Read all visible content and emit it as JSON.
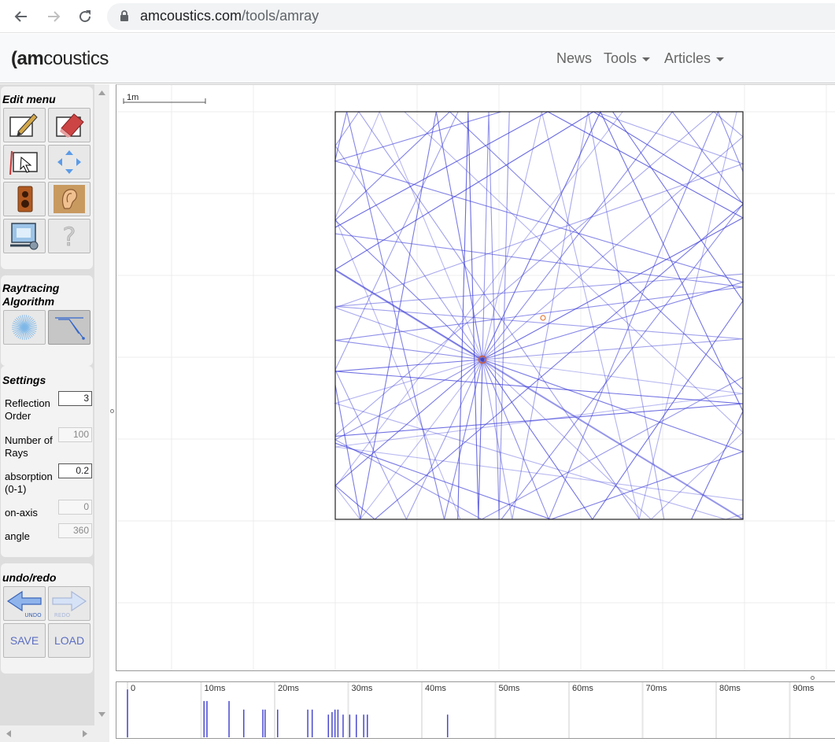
{
  "browser": {
    "url_host": "amcoustics.com",
    "url_path": "/tools/amray"
  },
  "site": {
    "logo_prefix": "(am",
    "logo_suffix": "coustics",
    "nav": {
      "news": "News",
      "tools": "Tools",
      "articles": "Articles"
    }
  },
  "panel": {
    "edit_menu_title": "Edit menu",
    "raytracing_title_line1": "Raytracing",
    "raytracing_title_line2": "Algorithm",
    "settings_title": "Settings",
    "settings": {
      "reflection_order_label_1": "Reflection",
      "reflection_order_label_2": "Order",
      "reflection_order_value": "3",
      "number_of_rays_label_1": "Number of",
      "number_of_rays_label_2": "Rays",
      "number_of_rays_value": "100",
      "absorption_label_1": "absorption",
      "absorption_label_2": "(0-1)",
      "absorption_value": "0.2",
      "on_axis_label": "on-axis",
      "on_axis_value": "0",
      "angle_label": "angle",
      "angle_value": "360"
    },
    "undo_redo_title": "undo/redo",
    "undo_label": "UNDO",
    "redo_label": "REDO",
    "save_label": "SAVE",
    "load_label": "LOAD"
  },
  "canvas": {
    "scale_label": "1m",
    "colors": {
      "ray": "#3a3ad8",
      "grid": "#ececec",
      "room_border": "#222222",
      "source": "#d06030",
      "listener": "#e08040"
    }
  },
  "impulse": {
    "tick_labels": [
      "0",
      "10ms",
      "20ms",
      "30ms",
      "40ms",
      "50ms",
      "60ms",
      "70ms",
      "80ms",
      "90ms"
    ],
    "arrival_times_ms": [
      0,
      10.4,
      10.8,
      13.8,
      15.8,
      18.4,
      18.7,
      20.4,
      24.5,
      25.1,
      27.3,
      27.8,
      28.2,
      28.6,
      29.3,
      30.2,
      31.1,
      32.1,
      32.6,
      43.5
    ],
    "arrival_levels": [
      0.95,
      0.72,
      0.72,
      0.72,
      0.55,
      0.55,
      0.55,
      0.55,
      0.55,
      0.55,
      0.45,
      0.5,
      0.55,
      0.55,
      0.45,
      0.45,
      0.45,
      0.45,
      0.45,
      0.45
    ],
    "colors": {
      "bar": "#4848d0",
      "grid": "#e6e6e6"
    }
  }
}
